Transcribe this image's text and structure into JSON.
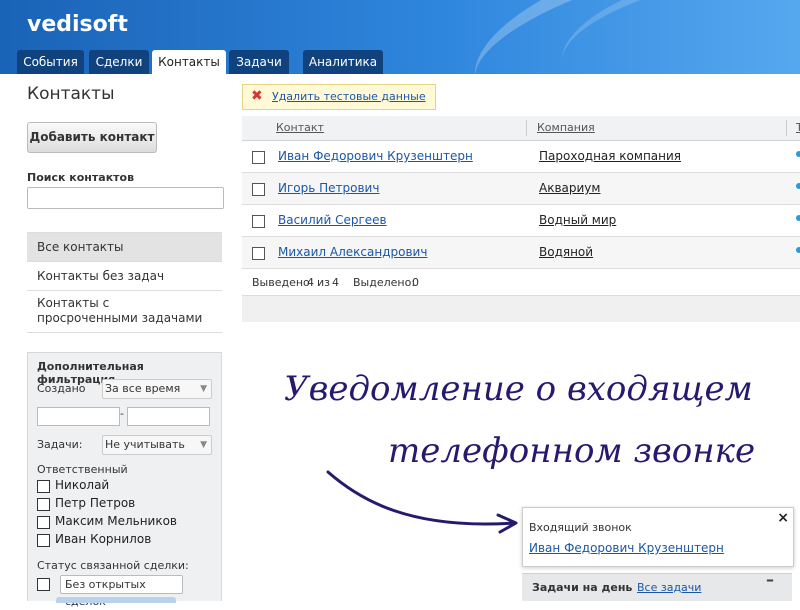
{
  "app": {
    "logo": "vedisoft"
  },
  "tabs": [
    {
      "label": "События"
    },
    {
      "label": "Сделки"
    },
    {
      "label": "Контакты",
      "active": true
    },
    {
      "label": "Задачи"
    },
    {
      "label": "Аналитика"
    }
  ],
  "page": {
    "title": "Контакты"
  },
  "sidebar": {
    "add_button": "Добавить контакт",
    "search_label": "Поиск контактов",
    "search_value": "",
    "nav": [
      {
        "label": "Все контакты",
        "active": true
      },
      {
        "label": "Контакты без задач"
      },
      {
        "label": "Контакты с просроченными задачами"
      }
    ],
    "filter": {
      "title": "Дополнительная фильтрация",
      "created_label": "Создано",
      "created_value": "За все время",
      "date_separator": "-",
      "tasks_label": "Задачи:",
      "tasks_value": "Не учитывать",
      "responsible_label": "Ответственный",
      "responsible": [
        "Николай",
        "Петр Петров",
        "Максим Мельников",
        "Иван Корнилов"
      ],
      "deal_status_label": "Статус связанной сделки:",
      "deal_status_option": "Без открытых сделок"
    }
  },
  "notice": {
    "icon": "close-x-icon",
    "link": "Удалить тестовые данные"
  },
  "table": {
    "columns": [
      "Контакт",
      "Компания",
      "Т"
    ],
    "rows": [
      {
        "name": "Иван Федорович Крузенштерн",
        "company": "Пароходная компания"
      },
      {
        "name": "Игорь Петрович",
        "company": "Аквариум"
      },
      {
        "name": "Василий Сергеев",
        "company": "Водный мир"
      },
      {
        "name": "Михаил Александрович",
        "company": "Водяной"
      }
    ],
    "footer": {
      "shown_label": "Выведено",
      "shown": "4",
      "of_label": "из",
      "total": "4",
      "selected_label": "Выделено:",
      "selected": "0"
    }
  },
  "annotation": {
    "line1": "Уведомление о входящем",
    "line2": "телефонном звонке"
  },
  "popup": {
    "title": "Входящий звонок",
    "caller": "Иван Федорович Крузенштерн",
    "close": "×"
  },
  "tasks_panel": {
    "title": "Задачи на день",
    "link": "Все задачи",
    "minimize": "–"
  },
  "colors": {
    "brand": "#1a63b7",
    "tab_dark": "#10427e",
    "link": "#1b57a6",
    "annotation_ink": "#261a6e"
  }
}
